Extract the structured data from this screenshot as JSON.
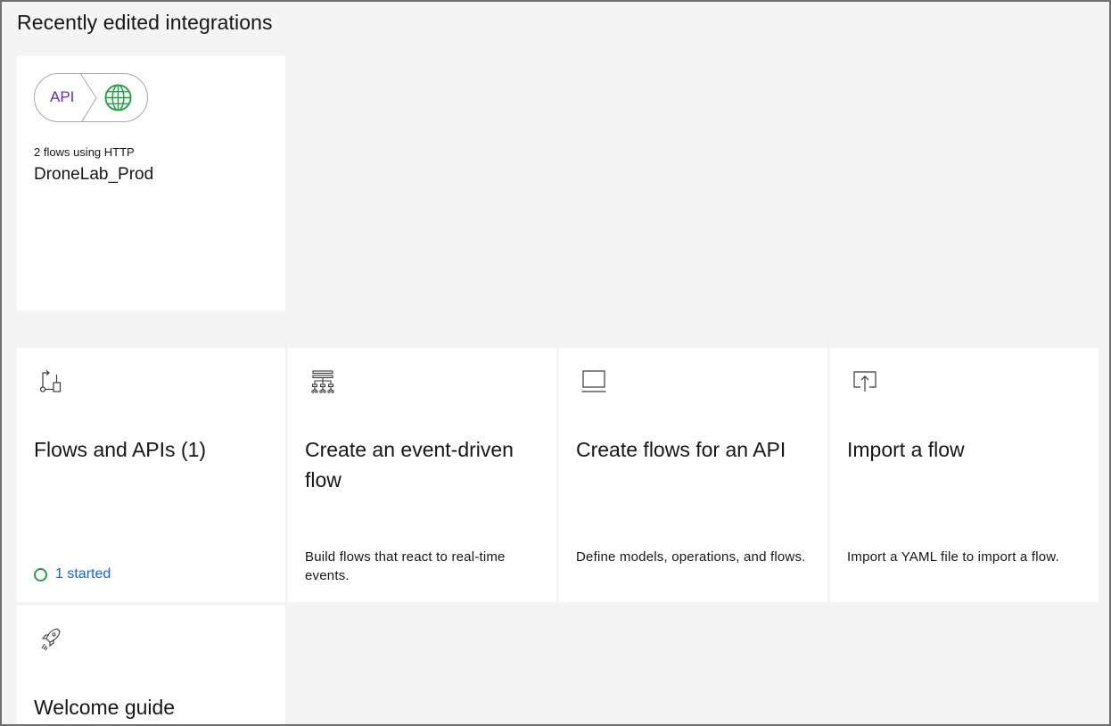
{
  "section": {
    "title": "Recently edited integrations"
  },
  "recent_card": {
    "badge_text": "API",
    "badge_icon": "globe-icon",
    "subtitle": "2 flows using HTTP",
    "name": "DroneLab_Prod"
  },
  "tiles": [
    {
      "icon": "flows-icon",
      "title": "Flows and APIs (1)",
      "status": "1 started",
      "status_color": "#24a148"
    },
    {
      "icon": "event-hierarchy-icon",
      "title": "Create an event-driven flow",
      "description": "Build flows that react to real-time events."
    },
    {
      "icon": "laptop-icon",
      "title": "Create flows for an API",
      "description": "Define models, operations, and flows."
    },
    {
      "icon": "upload-icon",
      "title": "Import a flow",
      "description": "Import a YAML file to import a flow."
    },
    {
      "icon": "rocket-icon",
      "title": "Welcome guide"
    }
  ],
  "colors": {
    "accent": "#6929c4",
    "globe": "#24a148",
    "link": "#0f62fe",
    "background": "#f4f4f4"
  }
}
